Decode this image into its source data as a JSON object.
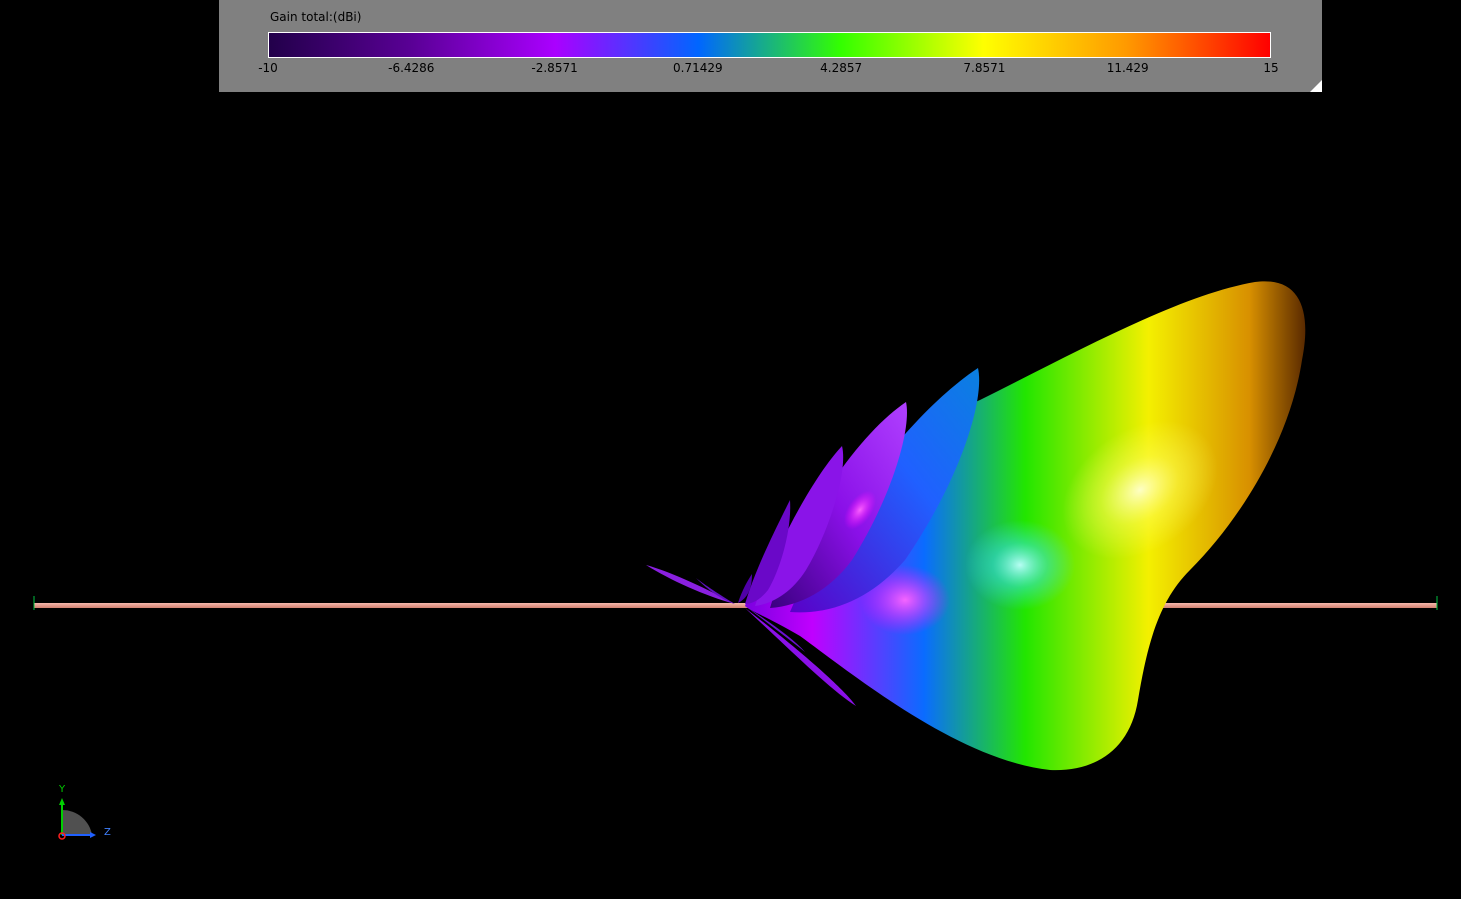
{
  "legend": {
    "title": "Gain total:(dBi)",
    "ticks": [
      "-10",
      "-6.4286",
      "-2.8571",
      "0.71429",
      "4.2857",
      "7.8571",
      "11.429",
      "15"
    ],
    "min": -10,
    "max": 15,
    "colormap": [
      "#22004a",
      "#5a0096",
      "#aa00ff",
      "#0066ff",
      "#33ff00",
      "#ffff00",
      "#ff9900",
      "#ff0000"
    ]
  },
  "triad": {
    "y_label": "Y",
    "z_label": "Z"
  },
  "colors": {
    "background": "#000000",
    "panel": "#808080",
    "ground_plane": "#f0a89a"
  }
}
